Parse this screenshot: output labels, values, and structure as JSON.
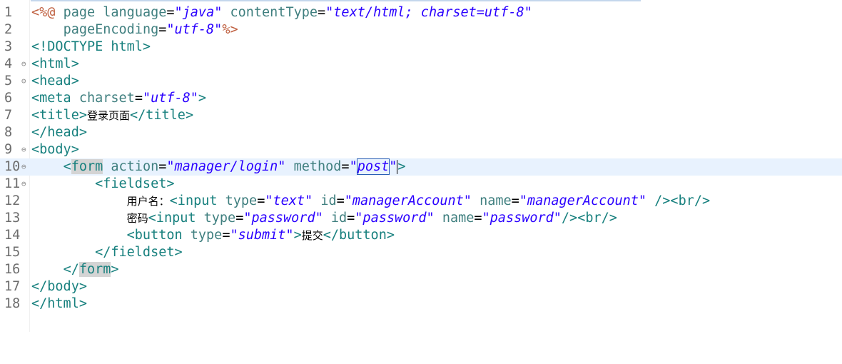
{
  "editor": {
    "lines": [
      {
        "n": "1",
        "fold": "",
        "code": "<%@ page language=\"java\" contentType=\"text/html; charset=utf-8\""
      },
      {
        "n": "2",
        "fold": "",
        "code": "    pageEncoding=\"utf-8\"%>"
      },
      {
        "n": "3",
        "fold": "",
        "code": "<!DOCTYPE html>"
      },
      {
        "n": "4",
        "fold": "⊖",
        "code": "<html>"
      },
      {
        "n": "5",
        "fold": "⊖",
        "code": "<head>"
      },
      {
        "n": "6",
        "fold": "",
        "code": "<meta charset=\"utf-8\">"
      },
      {
        "n": "7",
        "fold": "",
        "code": "<title>登录页面</title>"
      },
      {
        "n": "8",
        "fold": "",
        "code": "</head>"
      },
      {
        "n": "9",
        "fold": "⊖",
        "code": "<body>"
      },
      {
        "n": "10",
        "fold": "⊖",
        "code": "    <form action=\"manager/login\" method=\"post\">"
      },
      {
        "n": "11",
        "fold": "⊖",
        "code": "        <fieldset>"
      },
      {
        "n": "12",
        "fold": "",
        "code": "            用户名：<input type=\"text\" id=\"managerAccount\" name=\"managerAccount\" /><br/>"
      },
      {
        "n": "13",
        "fold": "",
        "code": "            密码<input type=\"password\" id=\"password\" name=\"password\"/><br/>"
      },
      {
        "n": "14",
        "fold": "",
        "code": "            <button type=\"submit\">提交</button>"
      },
      {
        "n": "15",
        "fold": "",
        "code": "        </fieldset>"
      },
      {
        "n": "16",
        "fold": "",
        "code": "    </form>"
      },
      {
        "n": "17",
        "fold": "",
        "code": "</body>"
      },
      {
        "n": "18",
        "fold": "",
        "code": "</html>"
      }
    ],
    "current_line": "10",
    "colors": {
      "tag": "#17807e",
      "string": "#2a00ff",
      "directive": "#bf5f3f",
      "current_line_bg": "#e8f2fe"
    }
  }
}
